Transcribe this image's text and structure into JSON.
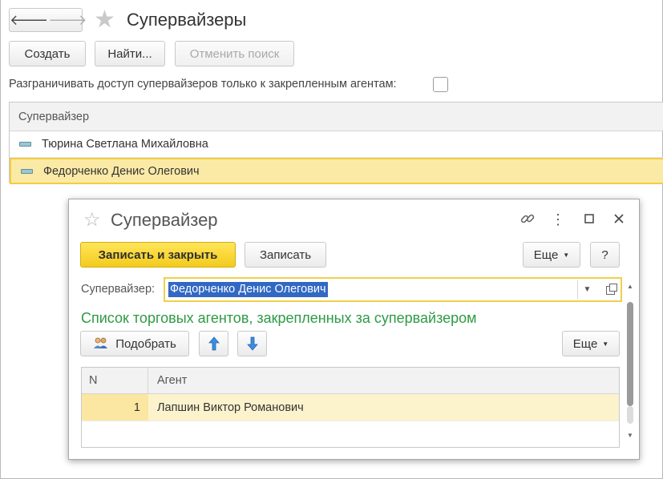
{
  "nav": {
    "back_icon": "arrow-left-icon",
    "forward_icon": "arrow-right-icon",
    "back_glyph": "🡐",
    "forward_glyph": "🡒"
  },
  "page": {
    "title": "Супервайзеры"
  },
  "toolbar": {
    "create_label": "Создать",
    "find_label": "Найти...",
    "cancel_search_label": "Отменить поиск"
  },
  "restrict": {
    "label": "Разграничивать доступ супервайзеров только к закрепленным агентам:",
    "checked": false
  },
  "list": {
    "header": "Супервайзер",
    "rows": [
      {
        "name": "Тюрина Светлана Михайловна",
        "selected": false
      },
      {
        "name": "Федорченко Денис Олегович",
        "selected": true
      }
    ]
  },
  "dialog": {
    "title": "Супервайзер",
    "more_glyph": "⋮",
    "buttons": {
      "save_close": "Записать и закрыть",
      "save": "Записать",
      "more": "Еще",
      "help": "?"
    },
    "field": {
      "label": "Супервайзер:",
      "value": "Федорченко Денис Олегович"
    },
    "section_title": "Список торговых агентов, закрепленных за супервайзером",
    "agents_toolbar": {
      "pick": "Подобрать",
      "more": "Еще"
    },
    "grid": {
      "columns": [
        "N",
        "Агент"
      ],
      "rows": [
        {
          "n": "1",
          "agent": "Лапшин Виктор Романович"
        }
      ]
    }
  },
  "colors": {
    "accent_yellow": "#f4cb1c",
    "selection": "#fbeaa5",
    "section_green": "#2e9a45",
    "input_selection": "#3168c4"
  }
}
